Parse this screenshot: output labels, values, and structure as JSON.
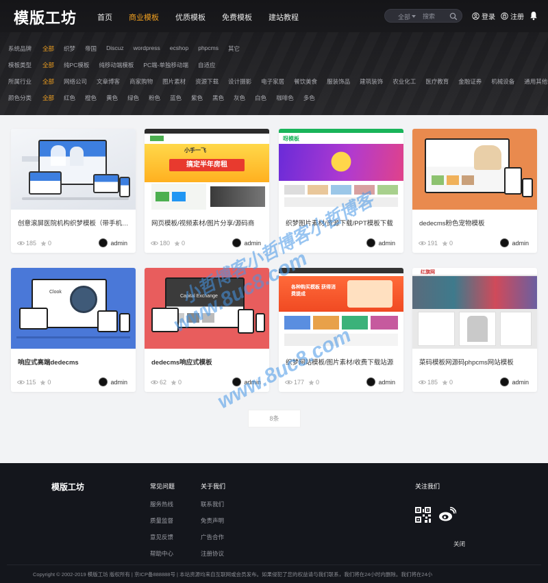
{
  "site": {
    "logo": "模版工坊"
  },
  "nav": {
    "items": [
      "首页",
      "商业模板",
      "优质模板",
      "免费模板",
      "建站教程"
    ],
    "active": "商业模板"
  },
  "search": {
    "scope": "全部",
    "placeholder": "搜索"
  },
  "auth": {
    "login": "登录",
    "register": "注册"
  },
  "filters": [
    {
      "label": "系统品牌",
      "options": [
        "全部",
        "织梦",
        "帝国",
        "Discuz",
        "wordpress",
        "ecshop",
        "phpcms",
        "其它"
      ]
    },
    {
      "label": "模板类型",
      "options": [
        "全部",
        "纯PC模板",
        "纯移动端模板",
        "PC端-单独移动端",
        "自适应"
      ]
    },
    {
      "label": "所属行业",
      "options": [
        "全部",
        "网络公司",
        "文章博客",
        "商家购物",
        "图片素材",
        "资源下载",
        "设计摄影",
        "电子家居",
        "餐饮美食",
        "服装饰品",
        "建筑装饰",
        "农业化工",
        "医疗教育",
        "金融证券",
        "机械设备",
        "通用其他"
      ]
    },
    {
      "label": "颜色分类",
      "options": [
        "全部",
        "红色",
        "橙色",
        "黄色",
        "绿色",
        "粉色",
        "蓝色",
        "紫色",
        "黑色",
        "灰色",
        "白色",
        "咖啡色",
        "多色"
      ]
    }
  ],
  "cards": [
    {
      "title": "创意滚屏医院机构织梦模板（带手机端）",
      "views": "185",
      "likes": "0",
      "author": "admin"
    },
    {
      "title": "网页模板/视频素材/图片分享/源码商",
      "views": "180",
      "likes": "0",
      "author": "admin"
    },
    {
      "title": "织梦图片素材/资源下载/PPT模板下载",
      "views": "",
      "likes": "",
      "author": "admin"
    },
    {
      "title": "dedecms粉色宠物模板",
      "views": "191",
      "likes": "0",
      "author": "admin"
    },
    {
      "title": "响应式高端dedecms",
      "views": "115",
      "likes": "0",
      "author": "admin"
    },
    {
      "title": "dedecms响应式模板",
      "views": "62",
      "likes": "0",
      "author": "admin"
    },
    {
      "title": "织梦网站模板/图片素材/收费下载站源",
      "views": "177",
      "likes": "0",
      "author": "admin"
    },
    {
      "title": "菜码模板网源码phpcms网站模板",
      "views": "185",
      "likes": "0",
      "author": "admin"
    }
  ],
  "thumb_text": {
    "t2_banner": "搞定半年房租",
    "t2_top": "小手一飞",
    "t3_logo": "呀模板",
    "t5_clock": "Clook",
    "t6_center": "Capital Exchange",
    "t7_banner": "各种购买模板 获得消费提成",
    "t8_header": "红旗网"
  },
  "pagination": {
    "label": "8条"
  },
  "watermark": {
    "line1": "小哲博客小哲博客小哲博客",
    "line2": "www.8uc8.com"
  },
  "footer": {
    "logo": "模版工坊",
    "col1": {
      "title": "常见问题",
      "links": [
        "服务热线",
        "质量监督",
        "意见反馈",
        "帮助中心"
      ]
    },
    "col2": {
      "title": "关于我们",
      "links": [
        "联系我们",
        "免责声明",
        "广告合作",
        "注册协议"
      ]
    },
    "follow": "关注我们",
    "close": "关闭",
    "copyright": "Copyright © 2002-2019 模版工坊 版权所有 | 京ICP备888888号 | 本站资源均来自互联网或会员发布。如果侵犯了您的权益请与我们联系，我们将在24小时内删除。我们将在24小"
  },
  "colors": {
    "accent": "#f0a020",
    "header_bg": "#18181b",
    "footer_bg": "#14161c",
    "page_bg": "#f2f3f5"
  }
}
